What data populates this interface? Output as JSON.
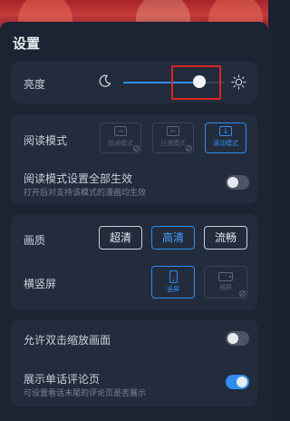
{
  "header": {
    "title": "设置"
  },
  "brightness": {
    "label": "亮度",
    "level_percent": 75
  },
  "reading_mode": {
    "label": "阅读模式",
    "options": [
      {
        "label": "普通模式",
        "glyph": "→",
        "selected": false,
        "disabled": true
      },
      {
        "label": "日漫模式",
        "glyph": "←",
        "selected": false,
        "disabled": true
      },
      {
        "label": "滚动模式",
        "glyph": "↓",
        "selected": true,
        "disabled": false
      }
    ],
    "apply_all": {
      "label": "阅读模式设置全部生效",
      "hint": "打开后对支持该模式的漫画均生效",
      "enabled": false
    }
  },
  "quality": {
    "label": "画质",
    "options": [
      "超清",
      "高清",
      "流畅"
    ],
    "selected_index": 1
  },
  "orientation": {
    "label": "横竖屏",
    "options": [
      {
        "label": "竖屏",
        "selected": true
      },
      {
        "label": "横屏",
        "selected": false,
        "disabled": true
      }
    ]
  },
  "double_tap_zoom": {
    "label": "允许双击缩放画面",
    "enabled": false
  },
  "episode_comments": {
    "label": "展示单话评论页",
    "hint": "可设置看话末尾的评论页是否展示",
    "enabled": true
  },
  "colors": {
    "accent": "#2f8df2",
    "background": "#1b2231",
    "card": "#232c3d",
    "highlight": "#e02424"
  }
}
